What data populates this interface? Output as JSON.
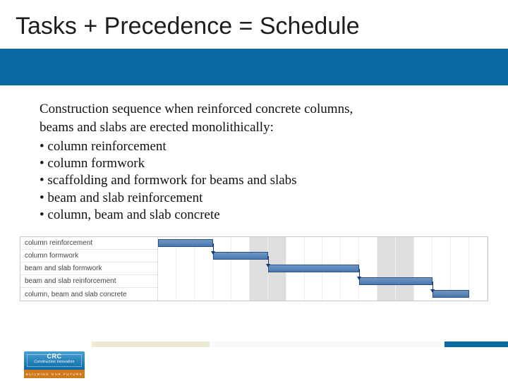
{
  "title": "Tasks + Precedence = Schedule",
  "intro_line1": "Construction sequence when reinforced concrete columns,",
  "intro_line2": "beams and slabs are erected monolithically:",
  "bullets": [
    "• column reinforcement",
    "• column formwork",
    "• scaffolding and formwork for beams and slabs",
    "• beam and slab reinforcement",
    "• column, beam and slab concrete"
  ],
  "chart_data": {
    "type": "bar",
    "tasks": [
      {
        "label": "column reinforcement",
        "start": 0,
        "duration": 3
      },
      {
        "label": "column formwork",
        "start": 3,
        "duration": 3
      },
      {
        "label": "beam and slab formwork",
        "start": 6,
        "duration": 5
      },
      {
        "label": "beam and slab reinforcement",
        "start": 11,
        "duration": 4
      },
      {
        "label": "column, beam and slab concrete",
        "start": 15,
        "duration": 2
      }
    ],
    "timeline_days": 18,
    "weekends": [
      5,
      6,
      12,
      13
    ]
  },
  "logo": {
    "crc": "CRC",
    "sub": "Construction Innovation",
    "tag": "BUILDING OUR FUTURE"
  }
}
